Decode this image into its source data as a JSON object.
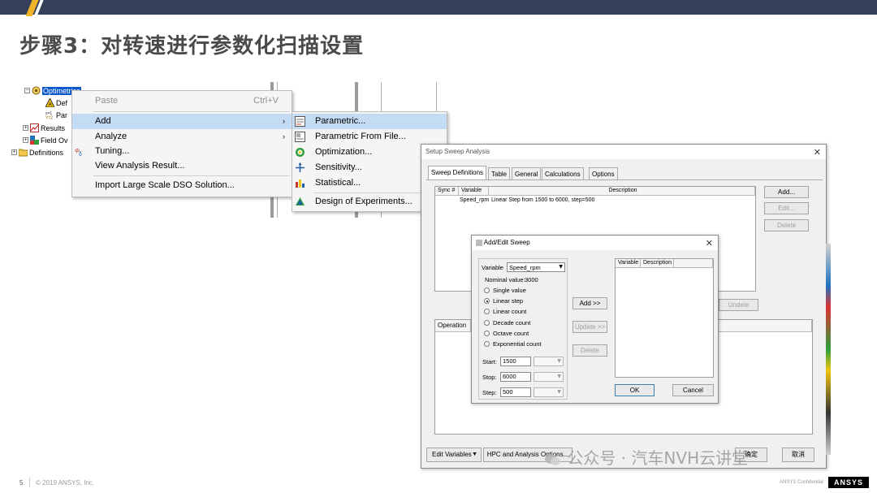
{
  "slide": {
    "title": "步骤3：对转速进行参数化扫描设置",
    "page_number": "5",
    "copyright": "© 2019 ANSYS, Inc.",
    "confidential": "ANSYS Confidential",
    "logo": "ANSYS",
    "watermark": "公众号 · 汽车NVH云讲堂",
    "colors": {
      "banner": "#34405a",
      "accent": "#f0b429",
      "selection": "#0a58ca",
      "menu_highlight": "#c3dcf4"
    }
  },
  "tree": {
    "items": [
      {
        "label": "Optimetrics",
        "icon": "optimetrics-icon",
        "expander": "⊟"
      },
      {
        "label": "Def",
        "icon": "optimization-icon"
      },
      {
        "label": "Par",
        "icon": "parametric-xy-icon"
      },
      {
        "label": "Results",
        "icon": "results-icon",
        "expander": "⊞"
      },
      {
        "label": "Field Ov",
        "icon": "field-overlay-icon",
        "expander": "⊞"
      },
      {
        "label": "Definitions",
        "icon": "folder-icon",
        "expander": "⊞"
      }
    ]
  },
  "context_menu": {
    "items": [
      {
        "label": "Paste",
        "shortcut": "Ctrl+V",
        "disabled": true
      },
      {
        "label": "Add",
        "has_submenu": true,
        "highlighted": true
      },
      {
        "label": "Analyze",
        "has_submenu": true
      },
      {
        "label": "Tuning...",
        "icon": "tuning-icon"
      },
      {
        "label": "View Analysis Result..."
      },
      {
        "label": "Import Large Scale DSO Solution..."
      }
    ]
  },
  "submenu": {
    "items": [
      {
        "label": "Parametric...",
        "icon": "parametric-icon",
        "highlighted": true
      },
      {
        "label": "Parametric From File...",
        "icon": "parametric-file-icon"
      },
      {
        "label": "Optimization...",
        "icon": "optimization-target-icon"
      },
      {
        "label": "Sensitivity...",
        "icon": "sensitivity-icon"
      },
      {
        "label": "Statistical...",
        "icon": "statistical-icon"
      },
      {
        "label": "Design of Experiments...",
        "icon": "doe-icon"
      }
    ]
  },
  "sweep_dialog": {
    "title": "Setup Sweep Analysis",
    "tabs": [
      "Sweep Definitions",
      "Table",
      "General",
      "Calculations",
      "Options"
    ],
    "table_headers": [
      "Sync #",
      "Variable",
      "Description"
    ],
    "rows": [
      {
        "sync": "",
        "variable": "Speed_rpm",
        "description": "Linear Step from 1500 to 6000, step=500"
      }
    ],
    "buttons": {
      "add": "Add...",
      "edit": "Edit...",
      "delete": "Delete",
      "undelete": "Undele"
    },
    "operation_header": "Operation",
    "bottom": {
      "edit_variables": "Edit Variables",
      "hpc": "HPC and Analysis Options...",
      "ok": "确定",
      "cancel": "取消"
    }
  },
  "edit_dialog": {
    "title": "Add/Edit Sweep",
    "variable_label": "Variable",
    "variable_value": "Speed_rpm",
    "nominal_label": "Nominal value:",
    "nominal_value": "3000",
    "options": [
      {
        "label": "Single value",
        "checked": false
      },
      {
        "label": "Linear step",
        "checked": true
      },
      {
        "label": "Linear count",
        "checked": false
      },
      {
        "label": "Decade count",
        "checked": false
      },
      {
        "label": "Octave count",
        "checked": false
      },
      {
        "label": "Exponential count",
        "checked": false
      }
    ],
    "start_label": "Start:",
    "start_value": "1500",
    "stop_label": "Stop:",
    "stop_value": "6000",
    "step_label": "Step:",
    "step_value": "500",
    "add_button": "Add >>",
    "update_button": "Update >>",
    "delete_button": "Delete",
    "list_headers": [
      "Variable",
      "Description"
    ],
    "ok": "OK",
    "cancel": "Cancel"
  }
}
